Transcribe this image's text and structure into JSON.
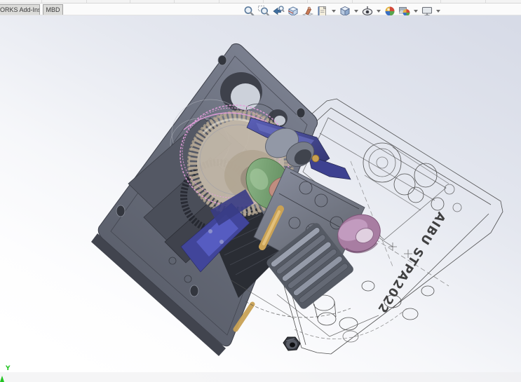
{
  "chrome": {
    "top_tabs": [
      {
        "label": "ORKS Add-Ins"
      },
      {
        "label": "MBD"
      }
    ]
  },
  "headsup": {
    "icons": [
      {
        "name": "zoom-to-fit"
      },
      {
        "name": "zoom-to-area"
      },
      {
        "name": "previous-view"
      },
      {
        "name": "section-view"
      },
      {
        "name": "dynamic-annotation-views"
      },
      {
        "name": "sheet-drawing-views"
      },
      {
        "name": "view-orientation"
      },
      {
        "name": "hide-show-items"
      },
      {
        "name": "edit-appearance"
      },
      {
        "name": "apply-scene"
      },
      {
        "name": "view-settings"
      }
    ]
  },
  "viewport": {
    "model_engraving": "AIBU STPA2022",
    "triad_y_label": "Y"
  },
  "colors": {
    "background_top": "#d7dbe7",
    "background_bottom": "#ffffff",
    "plate_gray": "#666b78",
    "gear_tan": "#c6bbaa",
    "accent_blue": "#4449a0",
    "green_part": "#76a273",
    "salmon_part": "#c08d80",
    "mauve_bushing": "#a87da2",
    "gold_rod": "#caa255",
    "selection_pink": "#e49fdd",
    "wireframe": "#3f3f3f",
    "triad_green": "#21c421"
  }
}
